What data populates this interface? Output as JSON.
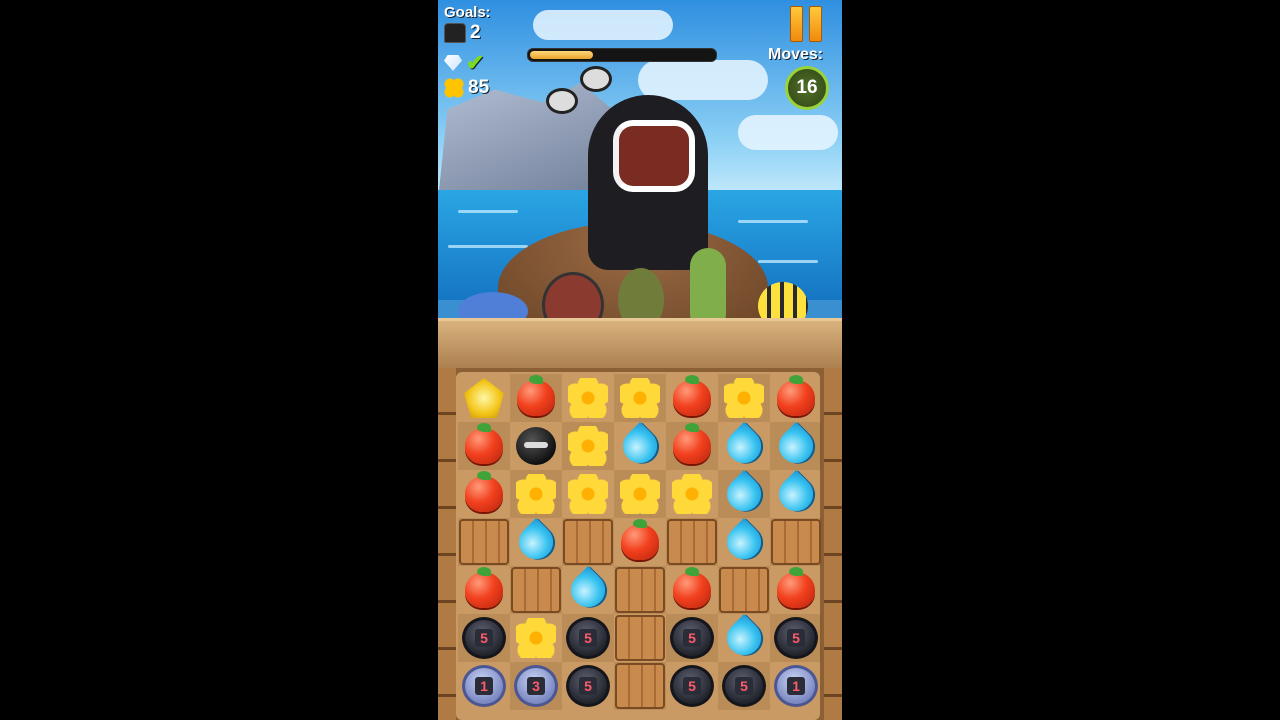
{
  "hud": {
    "goals_label": "Goals:",
    "boss_goal_count": "2",
    "gem_goal_status": "complete",
    "flower_goal_count": "85",
    "moves_label": "Moves:",
    "moves_count": "16",
    "boss_health_fraction": 0.34
  },
  "colors": {
    "apple": "#f2411e",
    "water": "#36c2f0",
    "flower": "#ffd93a",
    "moves_ring": "#9ad23a"
  },
  "board": {
    "rows": [
      [
        "star",
        "apple",
        "flower",
        "flower",
        "apple",
        "flower",
        "apple"
      ],
      [
        "apple",
        "ninja",
        "flower",
        "drop",
        "apple",
        "drop",
        "drop"
      ],
      [
        "apple",
        "flower",
        "flower",
        "flower",
        "flower",
        "drop",
        "drop"
      ],
      [
        "crate",
        "drop",
        "crate",
        "apple",
        "crate",
        "drop",
        "crate"
      ],
      [
        "apple",
        "crate",
        "drop",
        "crate",
        "apple",
        "crate",
        "apple"
      ],
      [
        "cage-dark:5",
        "flower",
        "cage-dark:5",
        "crate",
        "cage-dark:5",
        "drop",
        "cage-dark:5"
      ],
      [
        "cage-light:1",
        "cage-light:3",
        "cage-dark:5",
        "crate",
        "cage-dark:5",
        "cage-dark:5",
        "cage-light:1"
      ]
    ]
  }
}
